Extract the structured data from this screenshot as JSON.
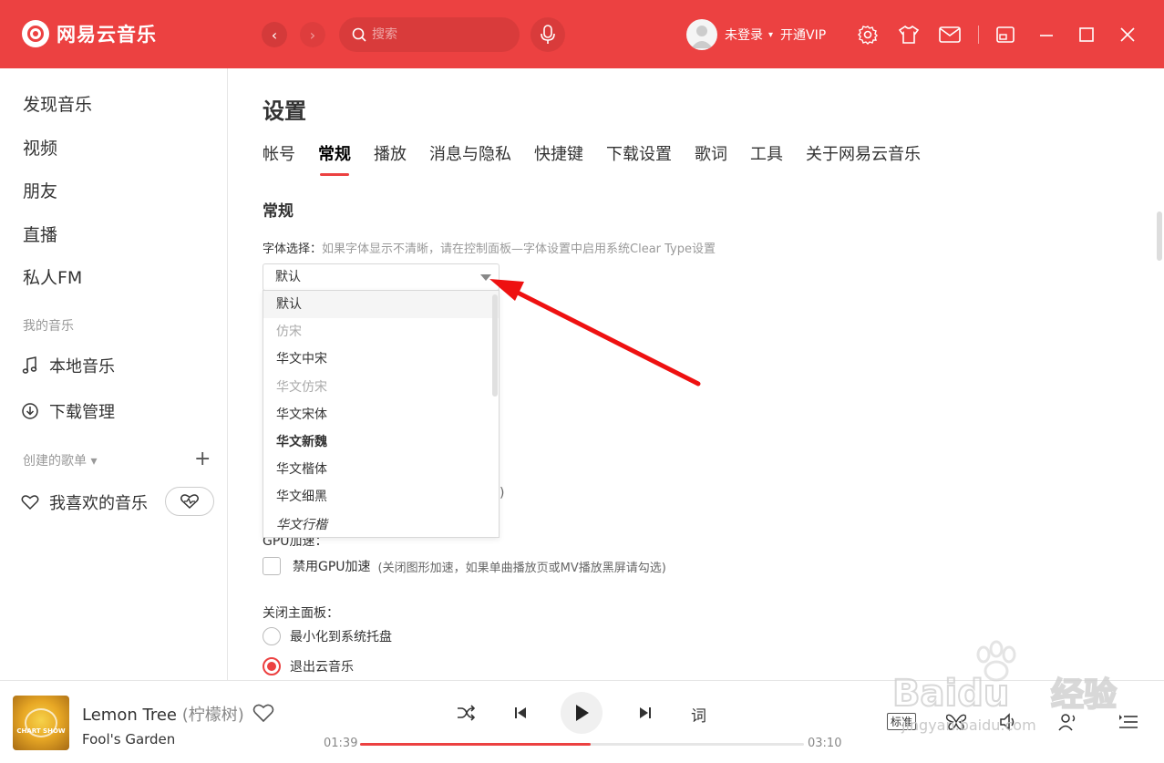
{
  "app": {
    "name": "网易云音乐"
  },
  "header": {
    "search_placeholder": "搜索",
    "user_name": "未登录",
    "vip_label": "开通VIP",
    "caret": "▾"
  },
  "nav": {
    "back": "‹",
    "forward": "›"
  },
  "sidebar": {
    "main_items": [
      "发现音乐",
      "视频",
      "朋友",
      "直播",
      "私人FM"
    ],
    "my_music_title": "我的音乐",
    "my_music_items": [
      "本地音乐",
      "下载管理"
    ],
    "playlists_title": "创建的歌单 ▾",
    "favorites": "我喜欢的音乐"
  },
  "settings": {
    "title": "设置",
    "tabs": [
      "帐号",
      "常规",
      "播放",
      "消息与隐私",
      "快捷键",
      "下载设置",
      "歌词",
      "工具",
      "关于网易云音乐"
    ],
    "active_tab": "常规",
    "section_title": "常规",
    "font_label": "字体选择：",
    "font_hint": "如果字体显示不清晰，请在控制面板—字体设置中启用系统Clear Type设置",
    "font_selected": "默认",
    "font_options": [
      "默认",
      "仿宋",
      "华文中宋",
      "华文仿宋",
      "华文宋体",
      "华文新魏",
      "华文楷体",
      "华文细黑",
      "华文行楷"
    ],
    "hidden_paren": ")",
    "gpu_label": "GPU加速：",
    "gpu_checkbox_label": "禁用GPU加速",
    "gpu_note": "(关闭图形加速，如果单曲播放页或MV播放黑屏请勾选)",
    "gpu_disabled": false,
    "close_label": "关闭主面板：",
    "close_options": [
      "最小化到系统托盘",
      "退出云音乐"
    ],
    "close_selected": "退出云音乐"
  },
  "player": {
    "cover_text": "CHART SHOW",
    "song_title": "Lemon Tree",
    "song_alt": "(柠檬树)",
    "artist": "Fool's Garden",
    "lyric_button": "词",
    "time_current": "01:39",
    "time_total": "03:10",
    "progress": 0.52,
    "quality": "标准"
  },
  "colors": {
    "accent": "#ec4141"
  },
  "watermark": {
    "brand": "Baidu",
    "text": "经验",
    "url": "jingyan.baidu.com"
  }
}
